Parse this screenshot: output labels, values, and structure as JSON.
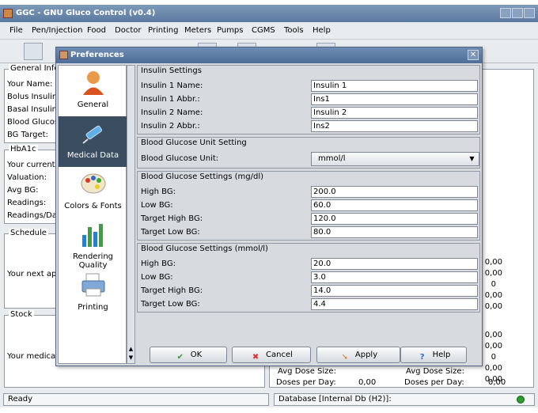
{
  "window": {
    "title": "GGC - GNU Gluco Control (v0.4)"
  },
  "menu": [
    "File",
    "Pen/Injection",
    "Food",
    "Doctor",
    "Printing",
    "Meters",
    "Pumps",
    "CGMS",
    "Tools",
    "Help"
  ],
  "main": {
    "general_title": "General Info",
    "general_labels": [
      "Your Name:",
      "Bolus Insulin",
      "Basal Insulin",
      "Blood Glucos",
      "BG Target:"
    ],
    "hba1c_title": "HbA1c",
    "hba1c_labels": [
      "Your current",
      "Valuation:",
      "Avg BG:",
      "Readings:",
      "Readings/Da"
    ],
    "schedule_title": "Schedule",
    "schedule_label": "Your next app",
    "stock_title": "Stock",
    "stock_label": "Your medica",
    "right_values_1": [
      "0,00",
      "0,00",
      "0",
      "0,00",
      "0,00"
    ],
    "right_values_2": [
      "0,00",
      "0,00",
      "0",
      "0,00",
      "0,00"
    ],
    "avg_dose_label": "Avg Dose Size:",
    "doses_per_day_label": "Doses per Day:",
    "doses_value": "0,00"
  },
  "status": {
    "left": "Ready",
    "database": "Database [Internal Db (H2)]:"
  },
  "dialog": {
    "title": "Preferences",
    "categories": [
      {
        "label": "General",
        "icon": "person-icon"
      },
      {
        "label": "Medical Data",
        "icon": "syringe-icon",
        "selected": true
      },
      {
        "label": "Colors & Fonts",
        "icon": "palette-icon"
      },
      {
        "label": "Rendering Quality",
        "icon": "bar-chart-icon"
      },
      {
        "label": "Printing",
        "icon": "printer-icon"
      }
    ],
    "insulin": {
      "title": "Insulin Settings",
      "rows": [
        {
          "label": "Insulin 1 Name:",
          "value": "Insulin 1"
        },
        {
          "label": "Insulin 1 Abbr.:",
          "value": "Ins1"
        },
        {
          "label": "Insulin 2 Name:",
          "value": "Insulin 2"
        },
        {
          "label": "Insulin 2 Abbr.:",
          "value": "Ins2"
        }
      ]
    },
    "bg_unit": {
      "title": "Blood Glucose Unit Setting",
      "label": "Blood Glucose Unit:",
      "value": "mmol/l"
    },
    "mgdl": {
      "title": "Blood Glucose Settings (mg/dl)",
      "rows": [
        {
          "label": "High BG:",
          "value": "200.0"
        },
        {
          "label": "Low BG:",
          "value": "60.0"
        },
        {
          "label": "Target High BG:",
          "value": "120.0"
        },
        {
          "label": "Target Low BG:",
          "value": "80.0"
        }
      ]
    },
    "mmol": {
      "title": "Blood Glucose Settings (mmol/l)",
      "rows": [
        {
          "label": "High BG:",
          "value": "20.0"
        },
        {
          "label": "Low BG:",
          "value": "3.0"
        },
        {
          "label": "Target High BG:",
          "value": "14.0"
        },
        {
          "label": "Target Low BG:",
          "value": "4.4"
        }
      ]
    },
    "buttons": {
      "ok": "OK",
      "cancel": "Cancel",
      "apply": "Apply",
      "help": "Help"
    }
  }
}
